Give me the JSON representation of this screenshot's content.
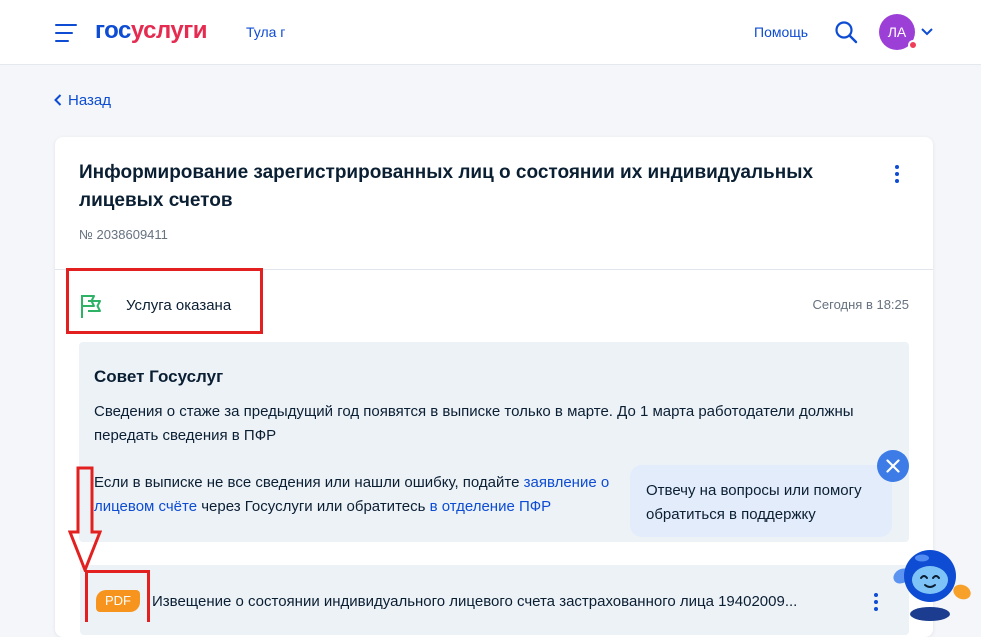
{
  "header": {
    "logo_part1": "гос",
    "logo_part2": "услуги",
    "city": "Тула г",
    "help_label": "Помощь",
    "avatar_initials": "ЛА"
  },
  "nav": {
    "back_label": "Назад"
  },
  "order": {
    "title": "Информирование зарегистрированных лиц о состоянии их индивидуальных лицевых счетов",
    "number": "№ 2038609411",
    "status": {
      "label": "Услуга оказана",
      "time": "Сегодня в 18:25"
    }
  },
  "tip": {
    "title": "Совет Госуслуг",
    "text1": "Сведения о стаже за предыдущий год появятся в выписке только в марте. До 1 марта работодатели должны передать сведения в ПФР",
    "text2_part1": "Если в выписке не все сведения или нашли ошибку, подайте ",
    "text2_link1": "заявление о",
    "text2_link1_cont": "лицевом счёте",
    "text2_part2": " через Госуслуги или обратитесь ",
    "text2_link2": "в отделение ПФР"
  },
  "chat": {
    "bubble_text": "Отвечу на вопросы или помогу обратиться в поддержку"
  },
  "file": {
    "badge": "PDF",
    "name": "Извещение о состоянии индивидуального лицевого счета застрахованного лица 19402009..."
  },
  "colors": {
    "brand_blue": "#0d4cd3",
    "brand_red": "#e52b50",
    "success_green": "#2eb265",
    "pdf_orange": "#f7941d",
    "annotation_red": "#e32020",
    "avatar_purple": "#9c3fd6"
  },
  "icons": [
    "menu-icon",
    "search-icon",
    "chevron-down-icon",
    "chevron-left-icon",
    "flag-icon",
    "more-vertical-icon",
    "close-icon",
    "assistant-robot-icon",
    "annotation-arrow-down"
  ]
}
